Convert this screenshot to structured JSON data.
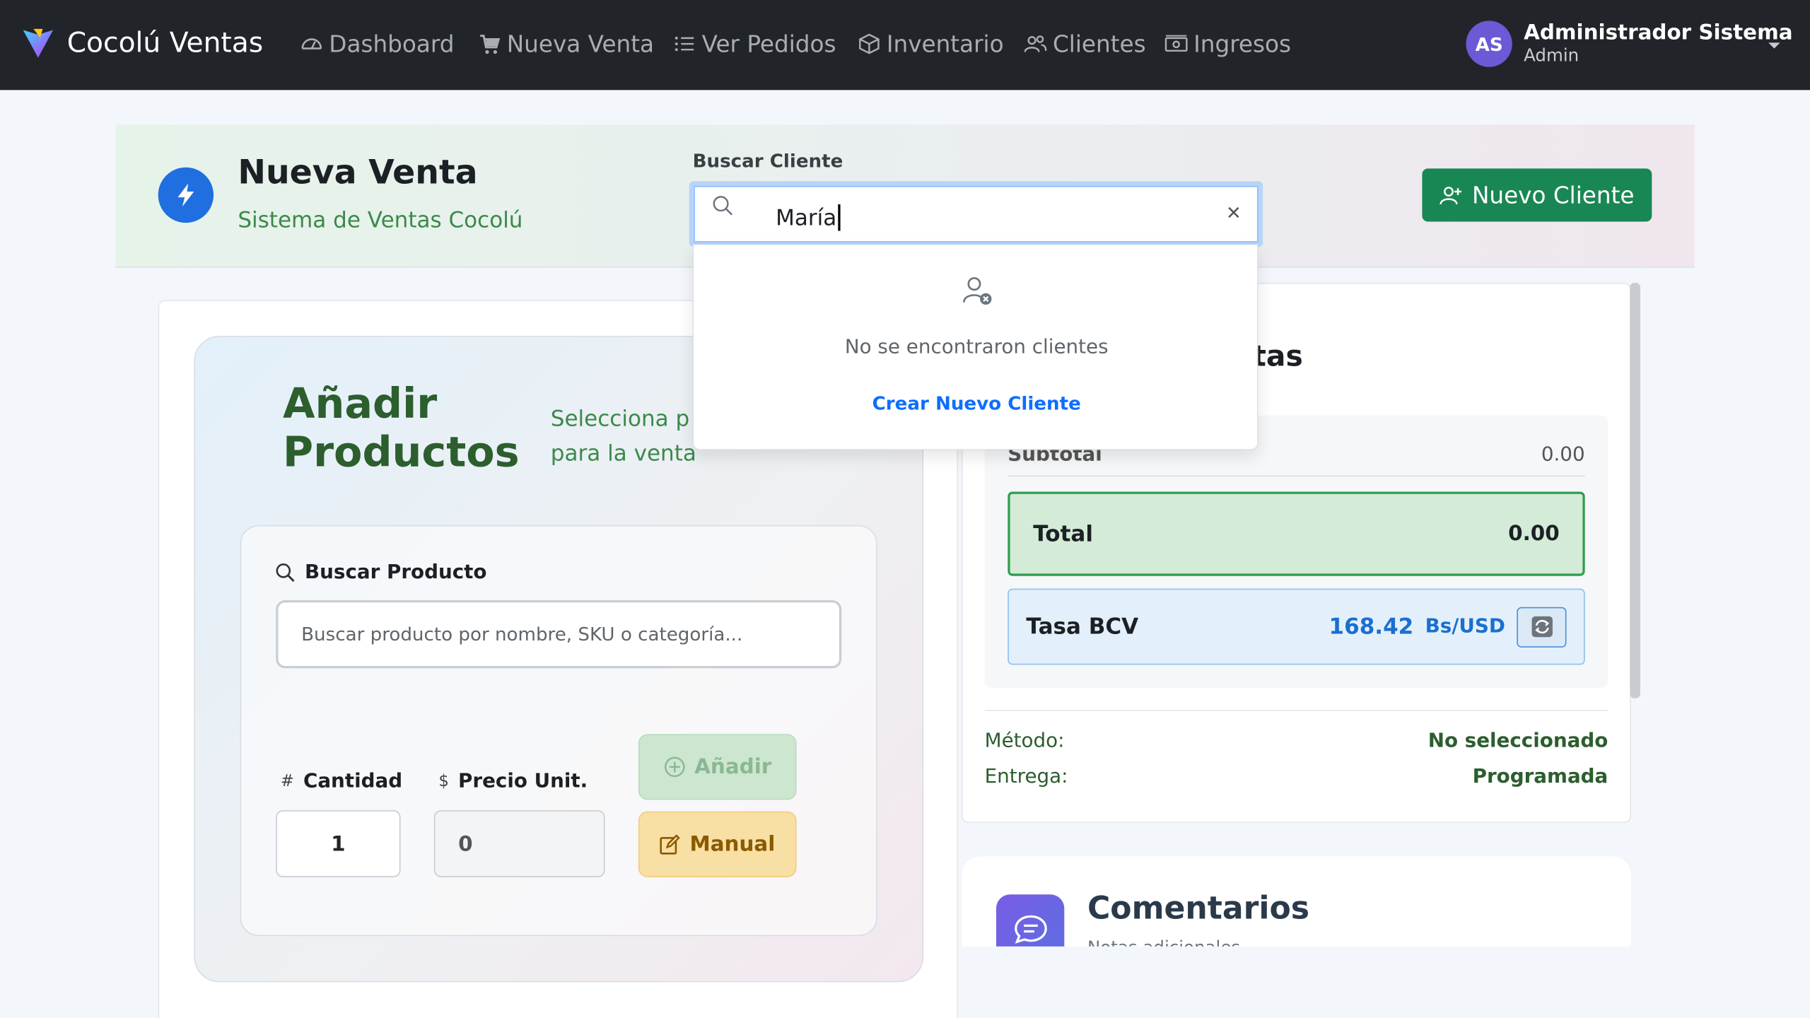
{
  "navbar": {
    "brand": "Cocolú Ventas",
    "items": [
      {
        "label": "Dashboard",
        "icon": "gauge-icon"
      },
      {
        "label": "Nueva Venta",
        "icon": "cart-icon"
      },
      {
        "label": "Ver Pedidos",
        "icon": "list-icon"
      },
      {
        "label": "Inventario",
        "icon": "box-icon"
      },
      {
        "label": "Clientes",
        "icon": "people-icon"
      },
      {
        "label": "Ingresos",
        "icon": "cash-icon"
      }
    ],
    "user": {
      "initials": "AS",
      "name": "Administrador Sistema",
      "role": "Admin"
    }
  },
  "header": {
    "title": "Nueva Venta",
    "subtitle": "Sistema de Ventas Cocolú",
    "search_label": "Buscar Cliente",
    "search_value": "María",
    "new_client_label": "Nuevo Cliente"
  },
  "client_dropdown": {
    "empty_message": "No se encontraron clientes",
    "create_link": "Crear Nuevo Cliente"
  },
  "products": {
    "title": "Añadir Productos",
    "subtitle": "Selecciona p para la venta",
    "search_label": "Buscar Producto",
    "search_placeholder": "Buscar producto por nombre, SKU o categoría...",
    "quantity_label": "Cantidad",
    "quantity_symbol": "#",
    "quantity_value": "1",
    "price_label": "Precio Unit.",
    "price_symbol": "$",
    "price_value": "0",
    "add_label": "Añadir",
    "manual_label": "Manual"
  },
  "summary": {
    "title_visible": "tas",
    "subtotal_label": "Subtotal",
    "subtotal_value": "0.00",
    "total_label": "Total",
    "total_value": "0.00",
    "tasa_label": "Tasa BCV",
    "tasa_value": "168.42",
    "tasa_unit": "Bs/USD",
    "method_label": "Método:",
    "method_value": "No seleccionado",
    "delivery_label": "Entrega:",
    "delivery_value": "Programada"
  },
  "comments": {
    "title": "Comentarios",
    "subtitle": "Notas adicionales"
  },
  "colors": {
    "navbar_bg": "#212529",
    "primary": "#0d6efd",
    "success": "#198754",
    "warning": "#f8dfa3",
    "accent_purple": "#6a5ad6"
  }
}
